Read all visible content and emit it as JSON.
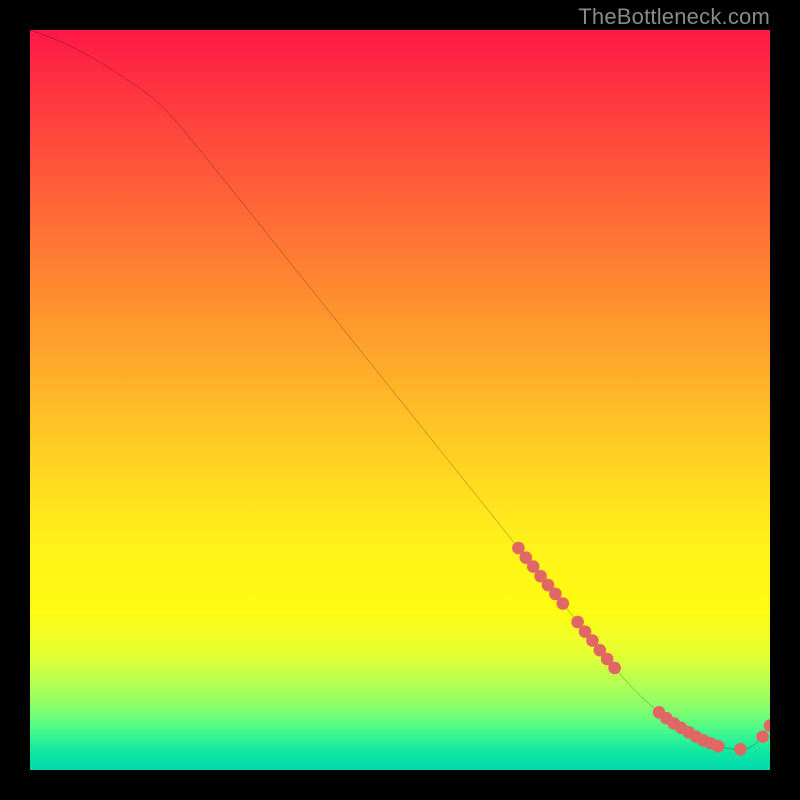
{
  "watermark": "TheBottleneck.com",
  "chart_data": {
    "type": "line",
    "title": "",
    "xlabel": "",
    "ylabel": "",
    "xlim": [
      0,
      100
    ],
    "ylim": [
      0,
      100
    ],
    "series": [
      {
        "name": "curve",
        "x": [
          0,
          4,
          8,
          12,
          18,
          26,
          34,
          42,
          50,
          58,
          66,
          72,
          78,
          82,
          86,
          90,
          93,
          96,
          98,
          100
        ],
        "y": [
          100,
          98.5,
          96.5,
          94,
          89.5,
          80,
          70,
          60,
          50,
          40,
          30,
          22.5,
          15,
          10.5,
          7,
          4.5,
          3.2,
          2.8,
          3.5,
          6
        ]
      }
    ],
    "markers": [
      {
        "x": 66,
        "y": 30
      },
      {
        "x": 67,
        "y": 28.7
      },
      {
        "x": 68,
        "y": 27.5
      },
      {
        "x": 69,
        "y": 26.2
      },
      {
        "x": 70,
        "y": 25
      },
      {
        "x": 71,
        "y": 23.8
      },
      {
        "x": 72,
        "y": 22.5
      },
      {
        "x": 74,
        "y": 20
      },
      {
        "x": 75,
        "y": 18.7
      },
      {
        "x": 76,
        "y": 17.5
      },
      {
        "x": 77,
        "y": 16.2
      },
      {
        "x": 78,
        "y": 15
      },
      {
        "x": 79,
        "y": 13.8
      },
      {
        "x": 85,
        "y": 7.8
      },
      {
        "x": 86,
        "y": 7
      },
      {
        "x": 87,
        "y": 6.3
      },
      {
        "x": 88,
        "y": 5.7
      },
      {
        "x": 89,
        "y": 5.1
      },
      {
        "x": 90,
        "y": 4.5
      },
      {
        "x": 91,
        "y": 4.0
      },
      {
        "x": 92,
        "y": 3.6
      },
      {
        "x": 93,
        "y": 3.2
      },
      {
        "x": 96,
        "y": 2.8
      },
      {
        "x": 99,
        "y": 4.5
      },
      {
        "x": 100,
        "y": 6
      }
    ],
    "marker_color": "#e06763",
    "curve_color": "#000000",
    "gradient_colors": {
      "top": "#ff1846",
      "mid": "#fff31a",
      "bottom": "#00d8b0"
    }
  }
}
